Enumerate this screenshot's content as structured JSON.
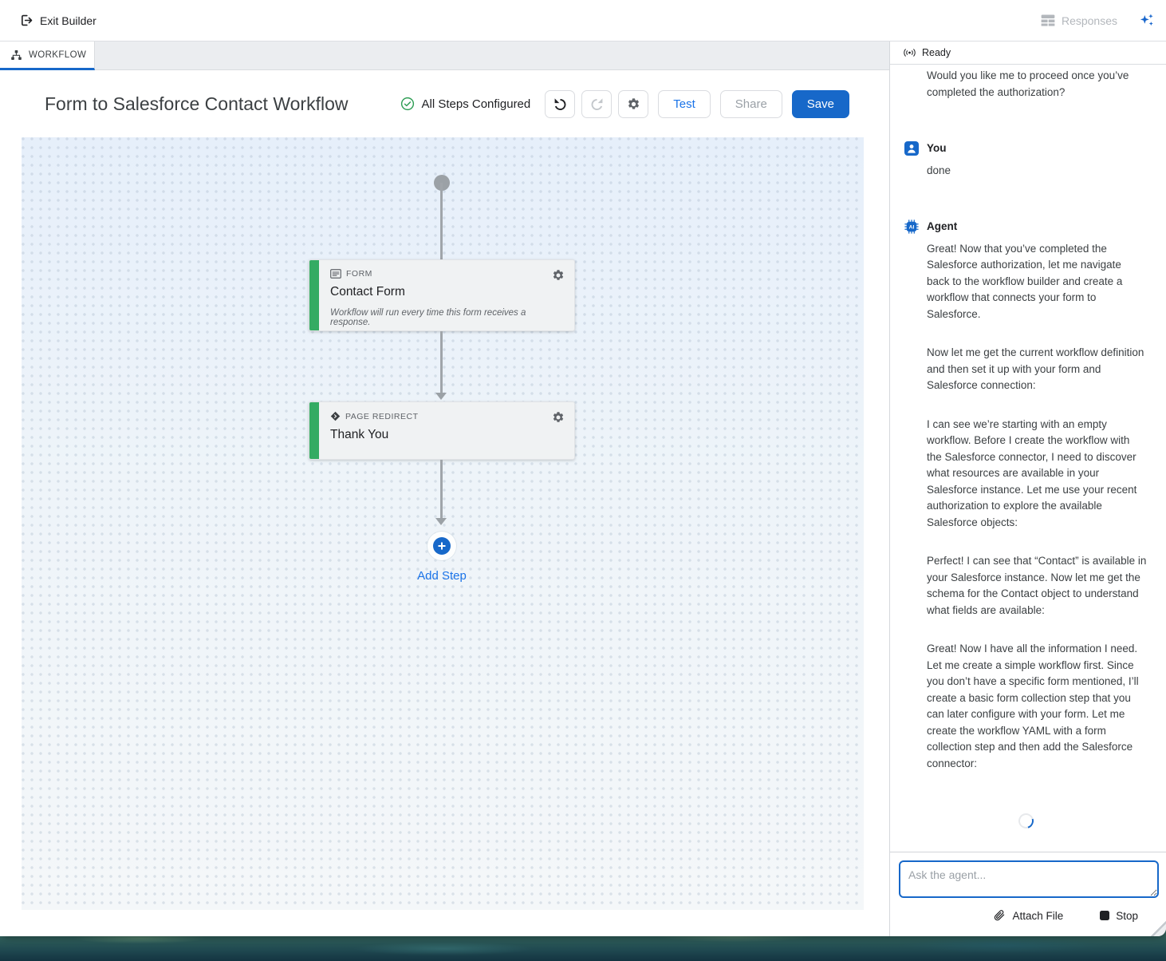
{
  "topbar": {
    "exit_label": "Exit Builder",
    "responses_label": "Responses"
  },
  "tabs": {
    "workflow_label": "WORKFLOW"
  },
  "builder": {
    "title": "Form to Salesforce Contact Workflow",
    "status_label": "All Steps Configured",
    "toolbar": {
      "test_label": "Test",
      "share_label": "Share",
      "save_label": "Save"
    },
    "steps": [
      {
        "type_label": "FORM",
        "title": "Contact Form",
        "note": "Workflow will run every time this form receives a response."
      },
      {
        "type_label": "PAGE REDIRECT",
        "title": "Thank You"
      }
    ],
    "add_step_label": "Add Step"
  },
  "chat": {
    "status_label": "Ready",
    "clipped_message": "Would you like me to proceed once you’ve completed the authorization?",
    "you": {
      "name": "You",
      "text": "done"
    },
    "agent": {
      "name": "Agent",
      "paragraphs": [
        "Great! Now that you’ve completed the Salesforce authorization, let me navigate back to the workflow builder and create a workflow that connects your form to Salesforce.",
        "Now let me get the current workflow definition and then set it up with your form and Salesforce connection:",
        "I can see we’re starting with an empty workflow. Before I create the workflow with the Salesforce connector, I need to discover what resources are available in your Salesforce instance. Let me use your recent authorization to explore the available Salesforce objects:",
        "Perfect! I can see that “Contact” is available in your Salesforce instance. Now let me get the schema for the Contact object to understand what fields are available:",
        "Great! Now I have all the information I need. Let me create a simple workflow first. Since you don’t have a specific form mentioned, I’ll create a basic form collection step that you can later configure with your form. Let me create the workflow YAML with a form collection step and then add the Salesforce connector:"
      ]
    },
    "composer": {
      "placeholder": "Ask the agent...",
      "attach_label": "Attach File",
      "stop_label": "Stop"
    }
  },
  "colors": {
    "accent_blue": "#1768c9",
    "link_blue": "#1a73e8",
    "step_green": "#34ab63",
    "check_green": "#2f9e55",
    "disabled_gray": "#9aa0a6"
  }
}
